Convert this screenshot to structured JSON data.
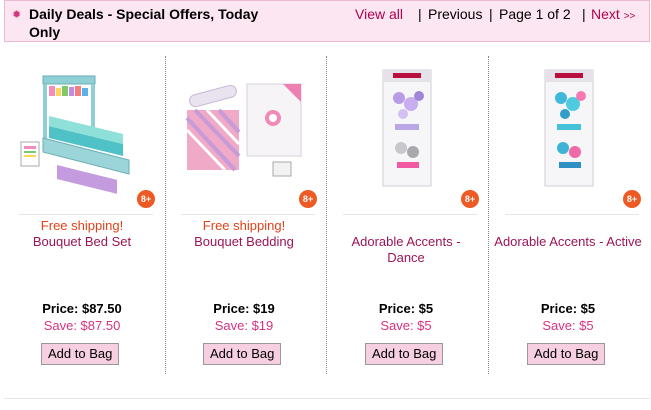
{
  "header": {
    "title": "Daily Deals - Special Offers, Today Only",
    "bullet": "✹",
    "view_all": "View all",
    "previous": "Previous",
    "page_info": "Page 1 of 2",
    "next": "Next",
    "next_arrows": ">>",
    "separator": "|"
  },
  "products": [
    {
      "shipping": "Free shipping!",
      "name": "Bouquet Bed Set",
      "price": "Price: $87.50",
      "save": "Save: $87.50",
      "age_badge": "8+",
      "button": "Add to Bag"
    },
    {
      "shipping": "Free shipping!",
      "name": "Bouquet Bedding",
      "price": "Price: $19",
      "save": "Save: $19",
      "age_badge": "8+",
      "button": "Add to Bag"
    },
    {
      "shipping": "",
      "name": "Adorable Accents - Dance",
      "price": "Price: $5",
      "save": "Save: $5",
      "age_badge": "8+",
      "button": "Add to Bag"
    },
    {
      "shipping": "",
      "name": "Adorable Accents - Active",
      "price": "Price: $5",
      "save": "Save: $5",
      "age_badge": "8+",
      "button": "Add to Bag"
    }
  ],
  "colors": {
    "header_bg": "#fbe6f1",
    "link": "#b3004f",
    "product_name": "#9c1556",
    "shipping": "#e0421a",
    "save": "#d6337f",
    "badge": "#ee5a24",
    "button_bg": "#f6cfe0"
  }
}
